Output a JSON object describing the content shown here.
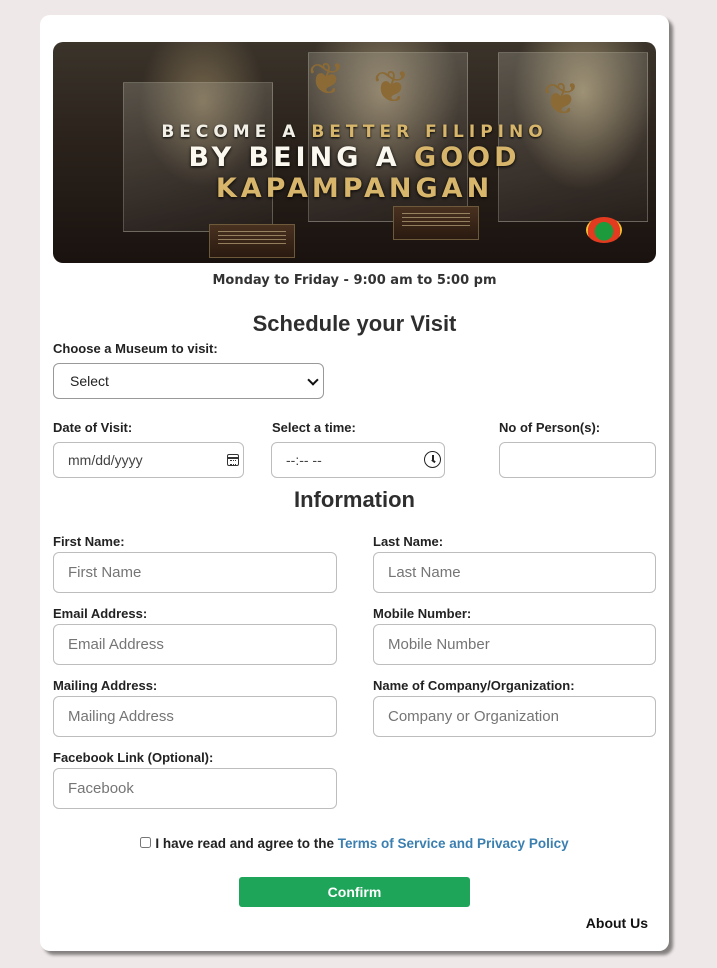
{
  "banner": {
    "line1_pre": "BECOME A ",
    "line1_hl": "BETTER FILIPINO",
    "line2_pre": "BY BEING A ",
    "line2_hl": "GOOD KAPAMPANGAN",
    "plaque_text": ""
  },
  "hours": "Monday to Friday - 9:00 am to 5:00 pm",
  "schedule": {
    "title": "Schedule your Visit",
    "museum_label": "Choose a Museum to visit:",
    "museum_selected": "Select",
    "date_label": "Date of Visit:",
    "date_placeholder": "mm/dd/yyyy",
    "time_label": "Select a time:",
    "time_placeholder": "--:-- --",
    "persons_label": "No of Person(s):"
  },
  "info": {
    "title": "Information",
    "first_name_label": "First Name:",
    "first_name_placeholder": "First Name",
    "last_name_label": "Last Name:",
    "last_name_placeholder": "Last Name",
    "email_label": "Email Address:",
    "email_placeholder": "Email Address",
    "mobile_label": "Mobile Number:",
    "mobile_placeholder": "Mobile Number",
    "mailing_label": "Mailing Address:",
    "mailing_placeholder": "Mailing Address",
    "company_label": "Name of Company/Organization:",
    "company_placeholder": "Company or Organization",
    "facebook_label": "Facebook Link (Optional):",
    "facebook_placeholder": "Facebook"
  },
  "terms": {
    "text": "I have read and agree to the ",
    "link": "Terms of Service and Privacy Policy"
  },
  "confirm_label": "Confirm",
  "about_label": "About Us",
  "colors": {
    "page_bg": "#efe8e8",
    "confirm_bg": "#1fa55a",
    "link": "#3a7fb0",
    "banner_highlight": "#d7b66c"
  }
}
